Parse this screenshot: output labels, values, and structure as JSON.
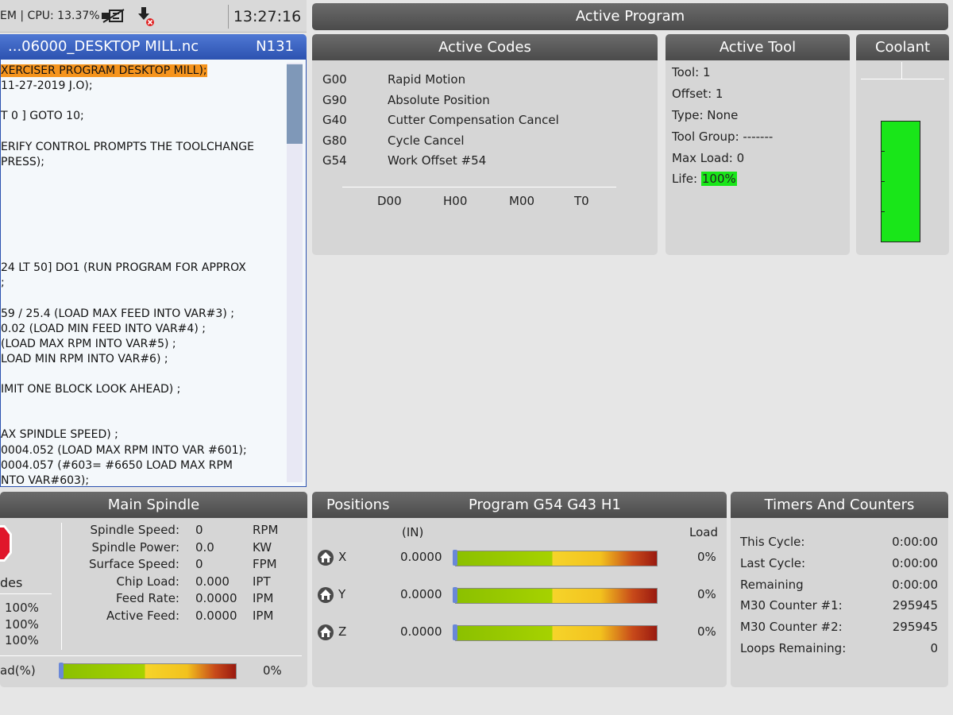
{
  "status": {
    "text": "EM | CPU: 13.37%",
    "time": "13:27:16"
  },
  "active_program": {
    "title": "Active Program"
  },
  "program": {
    "filename": "...06000_DESKTOP MILL.nc",
    "block": "N131",
    "lines": [
      "XERCISER PROGRAM DESKTOP MILL);",
      "11-27-2019 J.O);",
      "",
      "T 0 ] GOTO 10;",
      "",
      "ERIFY CONTROL PROMPTS THE TOOLCHANGE",
      "PRESS);",
      "",
      "",
      "",
      "",
      "",
      "",
      "24 LT 50] DO1 (RUN PROGRAM FOR APPROX",
      ";",
      "",
      "59 / 25.4 (LOAD MAX FEED INTO VAR#3) ;",
      "0.02 (LOAD MIN FEED INTO VAR#4) ;",
      "(LOAD MAX RPM INTO VAR#5) ;",
      "LOAD MIN RPM INTO VAR#6) ;",
      "",
      "IMIT ONE BLOCK LOOK AHEAD) ;",
      "",
      "",
      "AX SPINDLE SPEED) ;",
      "0004.052 (LOAD MAX RPM INTO VAR #601);",
      "0004.057 (#603= #6650 LOAD MAX RPM",
      "NTO VAR#603);"
    ]
  },
  "active_codes": {
    "title": "Active Codes",
    "rows": [
      {
        "code": "G00",
        "desc": "Rapid Motion"
      },
      {
        "code": "G90",
        "desc": "Absolute Position"
      },
      {
        "code": "G40",
        "desc": "Cutter Compensation Cancel"
      },
      {
        "code": "G80",
        "desc": "Cycle Cancel"
      },
      {
        "code": "G54",
        "desc": "Work Offset #54"
      }
    ],
    "footer": [
      "D00",
      "H00",
      "M00",
      "T0"
    ]
  },
  "active_tool": {
    "title": "Active Tool",
    "tool": "Tool: 1",
    "offset": "Offset: 1",
    "type": "Type: None",
    "group": "Tool Group: -------",
    "max_load": "Max Load: 0",
    "life_label": "Life:",
    "life_value": "100%"
  },
  "coolant": {
    "title": "Coolant",
    "level": 1.0
  },
  "spindle": {
    "title": "Main Spindle",
    "modes_label": "des",
    "overrides": [
      "100%",
      "100%",
      "100%"
    ],
    "rows": [
      {
        "label": "Spindle Speed:",
        "value": "0",
        "unit": "RPM"
      },
      {
        "label": "Spindle Power:",
        "value": "0.0",
        "unit": "KW"
      },
      {
        "label": "Surface Speed:",
        "value": "0",
        "unit": "FPM"
      },
      {
        "label": "Chip Load:",
        "value": "0.000",
        "unit": "IPT"
      },
      {
        "label": "Feed Rate:",
        "value": "0.0000",
        "unit": "IPM"
      },
      {
        "label": "Active Feed:",
        "value": "0.0000",
        "unit": "IPM"
      }
    ],
    "load_label": "ad(%)",
    "load_value": "0%"
  },
  "positions": {
    "title": "Positions",
    "program_label": "Program G54 G43 H1",
    "unit": "(IN)",
    "load_header": "Load",
    "axes": [
      {
        "axis": "X",
        "value": "0.0000",
        "load": "0%"
      },
      {
        "axis": "Y",
        "value": "0.0000",
        "load": "0%"
      },
      {
        "axis": "Z",
        "value": "0.0000",
        "load": "0%"
      }
    ]
  },
  "timers": {
    "title": "Timers And Counters",
    "rows": [
      {
        "label": "This Cycle:",
        "value": "0:00:00"
      },
      {
        "label": "Last Cycle:",
        "value": "0:00:00"
      },
      {
        "label": "Remaining",
        "value": "0:00:00"
      },
      {
        "label": "M30 Counter #1:",
        "value": "295945"
      },
      {
        "label": "M30 Counter #2:",
        "value": "295945"
      },
      {
        "label": "Loops Remaining:",
        "value": "0"
      }
    ]
  }
}
